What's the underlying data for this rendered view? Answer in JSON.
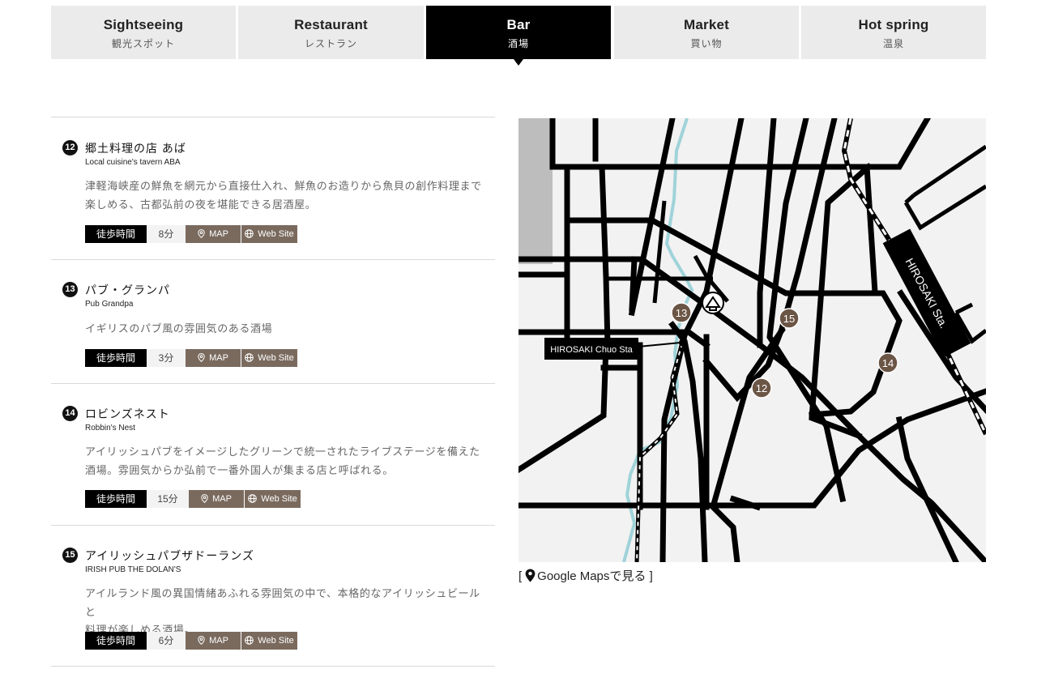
{
  "tabs": [
    {
      "en": "Sightseeing",
      "jp": "観光スポット",
      "active": false
    },
    {
      "en": "Restaurant",
      "jp": "レストラン",
      "active": false
    },
    {
      "en": "Bar",
      "jp": "酒場",
      "active": true
    },
    {
      "en": "Market",
      "jp": "買い物",
      "active": false
    },
    {
      "en": "Hot spring",
      "jp": "温泉",
      "active": false
    }
  ],
  "items": [
    {
      "number": "12",
      "name": "郷土料理の店 あば",
      "name_en": "Local cuisine's tavern ABA",
      "desc": [
        "津軽海峡産の鮮魚を網元から直接仕入れ、鮮魚のお造りから魚貝の創作料理まで",
        "楽しめる、古都弘前の夜を堪能できる居酒屋。"
      ],
      "walk_label": "徒歩時間",
      "walk_time": "8分",
      "map_label": "MAP",
      "web_label": "Web Site"
    },
    {
      "number": "13",
      "name": "パブ・グランパ",
      "name_en": "Pub Grandpa",
      "desc": [
        "イギリスのパブ風の雰囲気のある酒場"
      ],
      "walk_label": "徒歩時間",
      "walk_time": "3分",
      "map_label": "MAP",
      "web_label": "Web Site"
    },
    {
      "number": "14",
      "name": "ロビンズネスト",
      "name_en": "Robbin's Nest",
      "desc": [
        "アイリッシュパブをイメージしたグリーンで統一されたライブステージを備えた",
        "酒場。雰囲気からか弘前で一番外国人が集まる店と呼ばれる。"
      ],
      "walk_label": "徒歩時間",
      "walk_time": "15分",
      "map_label": "MAP",
      "web_label": "Web Site"
    },
    {
      "number": "15",
      "name": "アイリッシュパブザドーランズ",
      "name_en": "IRISH PUB THE DOLAN'S",
      "desc": [
        "アイルランド風の異国情緒あふれる雰囲気の中で、本格的なアイリッシュビールと",
        "料理が楽しめる酒場。"
      ],
      "walk_label": "徒歩時間",
      "walk_time": "6分",
      "map_label": "MAP",
      "web_label": "Web Site"
    }
  ],
  "map": {
    "station_main": "HIROSAKI Sta.",
    "station_chuo": "HIROSAKI Chuo Sta",
    "markers": [
      "12",
      "13",
      "14",
      "15"
    ],
    "colors": {
      "road": "#000000",
      "river": "#9fd3d9",
      "marker": "#6b5545",
      "background": "#f2f2f2",
      "block": "#bdbdbd"
    }
  },
  "maplink": {
    "open": "[",
    "label": "Google Mapsで見る",
    "close": "]"
  },
  "colors": {
    "accent": "#7a6a5e",
    "active_tab": "#000000",
    "tab": "#ebebeb"
  }
}
